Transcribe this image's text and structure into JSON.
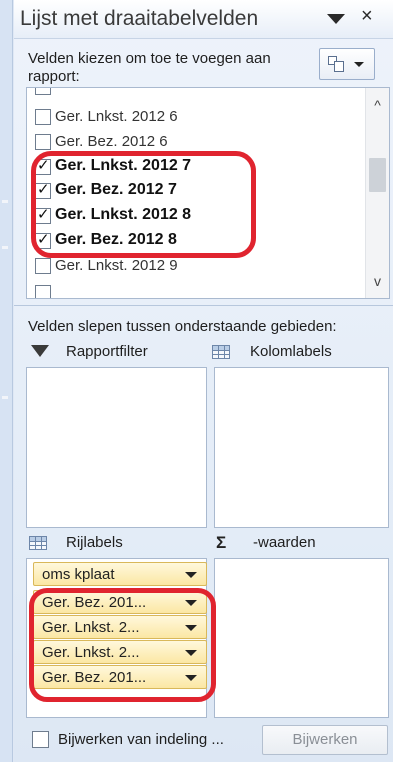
{
  "panel": {
    "title": "Lijst met draaitabelvelden",
    "close_glyph": "×"
  },
  "chooser": {
    "instruction": "Velden kiezen om toe te voegen aan rapport:"
  },
  "fields": [
    {
      "label": "",
      "checked": false
    },
    {
      "label": "Ger. Lnkst. 2012 6",
      "checked": false
    },
    {
      "label": "Ger. Bez. 2012 6",
      "checked": false
    },
    {
      "label": "Ger. Lnkst. 2012 7",
      "checked": true
    },
    {
      "label": "Ger. Bez. 2012 7",
      "checked": true
    },
    {
      "label": "Ger. Lnkst. 2012 8",
      "checked": true
    },
    {
      "label": "Ger. Bez. 2012 8",
      "checked": true
    },
    {
      "label": "Ger. Lnkst. 2012 9",
      "checked": false
    },
    {
      "label": "",
      "checked": false
    }
  ],
  "areas": {
    "instruction": "Velden slepen tussen onderstaande gebieden:",
    "report_filter": "Rapportfilter",
    "column_labels": "Kolomlabels",
    "row_labels": "Rijlabels",
    "values": "-waarden",
    "values_symbol": "Σ"
  },
  "row_items": [
    {
      "label": "oms kplaat"
    },
    {
      "label": "Ger. Bez. 201..."
    },
    {
      "label": "Ger. Lnkst. 2..."
    },
    {
      "label": "Ger. Lnkst. 2..."
    },
    {
      "label": "Ger. Bez. 201..."
    }
  ],
  "footer": {
    "defer_label": "Bijwerken van indeling ...",
    "update_button": "Bijwerken"
  },
  "icons": {
    "tick": "✓",
    "scroll_up": "^",
    "scroll_down": "v"
  },
  "colors": {
    "highlight": "#e0242f",
    "chip": "#fbe7a4"
  }
}
